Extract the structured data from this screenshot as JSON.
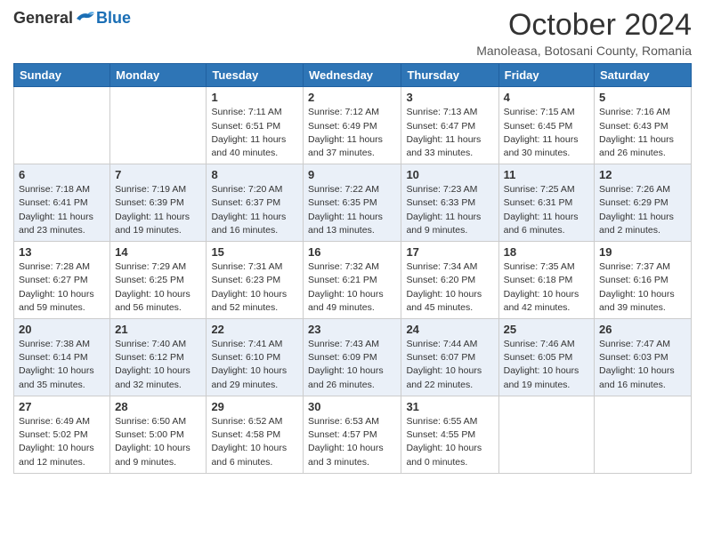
{
  "header": {
    "logo_general": "General",
    "logo_blue": "Blue",
    "month_title": "October 2024",
    "subtitle": "Manoleasa, Botosani County, Romania"
  },
  "weekdays": [
    "Sunday",
    "Monday",
    "Tuesday",
    "Wednesday",
    "Thursday",
    "Friday",
    "Saturday"
  ],
  "weeks": [
    [
      {
        "day": "",
        "sunrise": "",
        "sunset": "",
        "daylight": ""
      },
      {
        "day": "",
        "sunrise": "",
        "sunset": "",
        "daylight": ""
      },
      {
        "day": "1",
        "sunrise": "Sunrise: 7:11 AM",
        "sunset": "Sunset: 6:51 PM",
        "daylight": "Daylight: 11 hours and 40 minutes."
      },
      {
        "day": "2",
        "sunrise": "Sunrise: 7:12 AM",
        "sunset": "Sunset: 6:49 PM",
        "daylight": "Daylight: 11 hours and 37 minutes."
      },
      {
        "day": "3",
        "sunrise": "Sunrise: 7:13 AM",
        "sunset": "Sunset: 6:47 PM",
        "daylight": "Daylight: 11 hours and 33 minutes."
      },
      {
        "day": "4",
        "sunrise": "Sunrise: 7:15 AM",
        "sunset": "Sunset: 6:45 PM",
        "daylight": "Daylight: 11 hours and 30 minutes."
      },
      {
        "day": "5",
        "sunrise": "Sunrise: 7:16 AM",
        "sunset": "Sunset: 6:43 PM",
        "daylight": "Daylight: 11 hours and 26 minutes."
      }
    ],
    [
      {
        "day": "6",
        "sunrise": "Sunrise: 7:18 AM",
        "sunset": "Sunset: 6:41 PM",
        "daylight": "Daylight: 11 hours and 23 minutes."
      },
      {
        "day": "7",
        "sunrise": "Sunrise: 7:19 AM",
        "sunset": "Sunset: 6:39 PM",
        "daylight": "Daylight: 11 hours and 19 minutes."
      },
      {
        "day": "8",
        "sunrise": "Sunrise: 7:20 AM",
        "sunset": "Sunset: 6:37 PM",
        "daylight": "Daylight: 11 hours and 16 minutes."
      },
      {
        "day": "9",
        "sunrise": "Sunrise: 7:22 AM",
        "sunset": "Sunset: 6:35 PM",
        "daylight": "Daylight: 11 hours and 13 minutes."
      },
      {
        "day": "10",
        "sunrise": "Sunrise: 7:23 AM",
        "sunset": "Sunset: 6:33 PM",
        "daylight": "Daylight: 11 hours and 9 minutes."
      },
      {
        "day": "11",
        "sunrise": "Sunrise: 7:25 AM",
        "sunset": "Sunset: 6:31 PM",
        "daylight": "Daylight: 11 hours and 6 minutes."
      },
      {
        "day": "12",
        "sunrise": "Sunrise: 7:26 AM",
        "sunset": "Sunset: 6:29 PM",
        "daylight": "Daylight: 11 hours and 2 minutes."
      }
    ],
    [
      {
        "day": "13",
        "sunrise": "Sunrise: 7:28 AM",
        "sunset": "Sunset: 6:27 PM",
        "daylight": "Daylight: 10 hours and 59 minutes."
      },
      {
        "day": "14",
        "sunrise": "Sunrise: 7:29 AM",
        "sunset": "Sunset: 6:25 PM",
        "daylight": "Daylight: 10 hours and 56 minutes."
      },
      {
        "day": "15",
        "sunrise": "Sunrise: 7:31 AM",
        "sunset": "Sunset: 6:23 PM",
        "daylight": "Daylight: 10 hours and 52 minutes."
      },
      {
        "day": "16",
        "sunrise": "Sunrise: 7:32 AM",
        "sunset": "Sunset: 6:21 PM",
        "daylight": "Daylight: 10 hours and 49 minutes."
      },
      {
        "day": "17",
        "sunrise": "Sunrise: 7:34 AM",
        "sunset": "Sunset: 6:20 PM",
        "daylight": "Daylight: 10 hours and 45 minutes."
      },
      {
        "day": "18",
        "sunrise": "Sunrise: 7:35 AM",
        "sunset": "Sunset: 6:18 PM",
        "daylight": "Daylight: 10 hours and 42 minutes."
      },
      {
        "day": "19",
        "sunrise": "Sunrise: 7:37 AM",
        "sunset": "Sunset: 6:16 PM",
        "daylight": "Daylight: 10 hours and 39 minutes."
      }
    ],
    [
      {
        "day": "20",
        "sunrise": "Sunrise: 7:38 AM",
        "sunset": "Sunset: 6:14 PM",
        "daylight": "Daylight: 10 hours and 35 minutes."
      },
      {
        "day": "21",
        "sunrise": "Sunrise: 7:40 AM",
        "sunset": "Sunset: 6:12 PM",
        "daylight": "Daylight: 10 hours and 32 minutes."
      },
      {
        "day": "22",
        "sunrise": "Sunrise: 7:41 AM",
        "sunset": "Sunset: 6:10 PM",
        "daylight": "Daylight: 10 hours and 29 minutes."
      },
      {
        "day": "23",
        "sunrise": "Sunrise: 7:43 AM",
        "sunset": "Sunset: 6:09 PM",
        "daylight": "Daylight: 10 hours and 26 minutes."
      },
      {
        "day": "24",
        "sunrise": "Sunrise: 7:44 AM",
        "sunset": "Sunset: 6:07 PM",
        "daylight": "Daylight: 10 hours and 22 minutes."
      },
      {
        "day": "25",
        "sunrise": "Sunrise: 7:46 AM",
        "sunset": "Sunset: 6:05 PM",
        "daylight": "Daylight: 10 hours and 19 minutes."
      },
      {
        "day": "26",
        "sunrise": "Sunrise: 7:47 AM",
        "sunset": "Sunset: 6:03 PM",
        "daylight": "Daylight: 10 hours and 16 minutes."
      }
    ],
    [
      {
        "day": "27",
        "sunrise": "Sunrise: 6:49 AM",
        "sunset": "Sunset: 5:02 PM",
        "daylight": "Daylight: 10 hours and 12 minutes."
      },
      {
        "day": "28",
        "sunrise": "Sunrise: 6:50 AM",
        "sunset": "Sunset: 5:00 PM",
        "daylight": "Daylight: 10 hours and 9 minutes."
      },
      {
        "day": "29",
        "sunrise": "Sunrise: 6:52 AM",
        "sunset": "Sunset: 4:58 PM",
        "daylight": "Daylight: 10 hours and 6 minutes."
      },
      {
        "day": "30",
        "sunrise": "Sunrise: 6:53 AM",
        "sunset": "Sunset: 4:57 PM",
        "daylight": "Daylight: 10 hours and 3 minutes."
      },
      {
        "day": "31",
        "sunrise": "Sunrise: 6:55 AM",
        "sunset": "Sunset: 4:55 PM",
        "daylight": "Daylight: 10 hours and 0 minutes."
      },
      {
        "day": "",
        "sunrise": "",
        "sunset": "",
        "daylight": ""
      },
      {
        "day": "",
        "sunrise": "",
        "sunset": "",
        "daylight": ""
      }
    ]
  ]
}
